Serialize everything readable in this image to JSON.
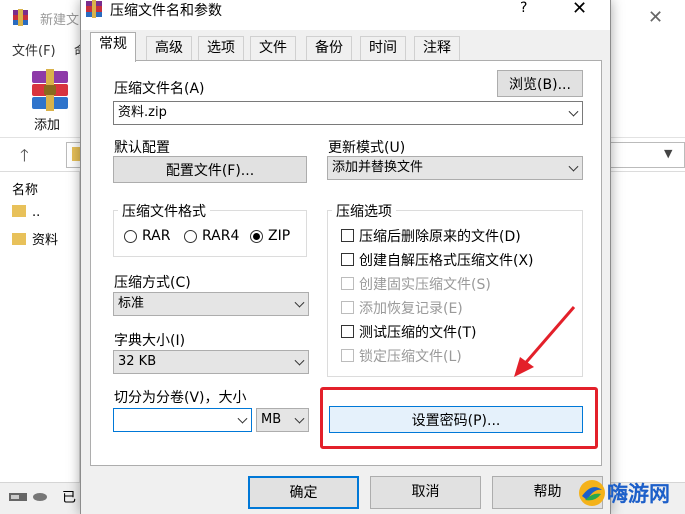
{
  "background_window": {
    "title": "新建文",
    "menu_items": [
      "文件(F)",
      "命"
    ],
    "toolbar_add_label": "添加",
    "list_header": "名称",
    "list_items": [
      "..",
      "资料"
    ],
    "status_text": "已"
  },
  "dialog": {
    "title": "压缩文件名和参数",
    "help_glyph": "?",
    "close_glyph": "✕",
    "tabs": [
      "常规",
      "高级",
      "选项",
      "文件",
      "备份",
      "时间",
      "注释"
    ],
    "active_tab": "常规",
    "archive_name_label": "压缩文件名(A)",
    "archive_name_label_u": "A",
    "browse_button": "浏览(B)...",
    "archive_name_value": "资料.zip",
    "default_profile_label": "默认配置",
    "profile_button": "配置文件(F)...",
    "update_mode_label": "更新模式(U)",
    "update_mode_value": "添加并替换文件",
    "format_group_title": "压缩文件格式",
    "format_options": [
      "RAR",
      "RAR4",
      "ZIP"
    ],
    "format_selected": "ZIP",
    "method_label": "压缩方式(C)",
    "method_value": "标准",
    "dict_label": "字典大小(I)",
    "dict_value": "32 KB",
    "split_label": "切分为分卷(V)，大小",
    "split_value": "",
    "split_unit": "MB",
    "options_group_title": "压缩选项",
    "options": [
      {
        "label": "压缩后删除原来的文件(D)",
        "checked": false,
        "enabled": true
      },
      {
        "label": "创建自解压格式压缩文件(X)",
        "checked": false,
        "enabled": true
      },
      {
        "label": "创建固实压缩文件(S)",
        "checked": false,
        "enabled": false
      },
      {
        "label": "添加恢复记录(E)",
        "checked": false,
        "enabled": false
      },
      {
        "label": "测试压缩的文件(T)",
        "checked": false,
        "enabled": true
      },
      {
        "label": "锁定压缩文件(L)",
        "checked": false,
        "enabled": false
      }
    ],
    "set_password_button": "设置密码(P)...",
    "ok_button": "确定",
    "cancel_button": "取消",
    "help_button": "帮助"
  },
  "annotation": {
    "highlight_color": "#e3202a"
  },
  "watermark": {
    "text": "嗨游网"
  }
}
